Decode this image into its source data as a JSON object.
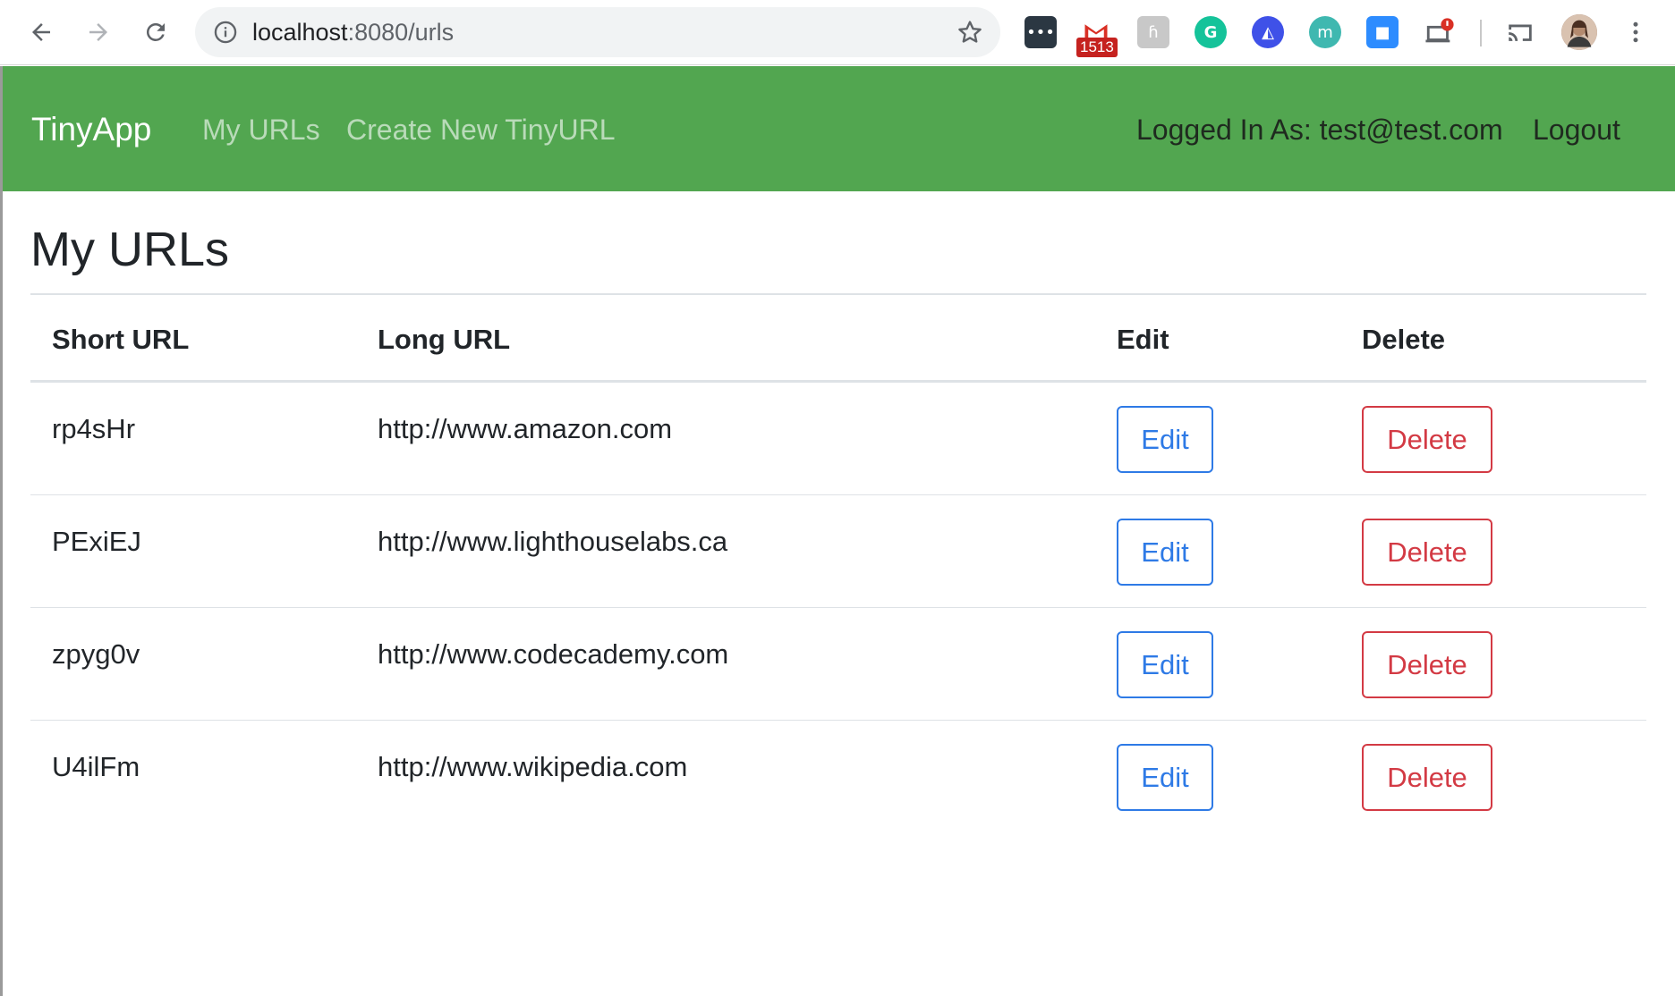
{
  "browser": {
    "url_host": "localhost",
    "url_rest": ":8080/urls",
    "gmail_count": "1513"
  },
  "navbar": {
    "brand": "TinyApp",
    "links": [
      "My URLs",
      "Create New TinyURL"
    ],
    "logged_in": "Logged In As: test@test.com",
    "logout": "Logout"
  },
  "main": {
    "title": "My URLs",
    "columns": [
      "Short URL",
      "Long URL",
      "Edit",
      "Delete"
    ],
    "rows": [
      {
        "short": "rp4sHr",
        "long": "http://www.amazon.com",
        "edit": "Edit",
        "delete": "Delete"
      },
      {
        "short": "PExiEJ",
        "long": "http://www.lighthouselabs.ca",
        "edit": "Edit",
        "delete": "Delete"
      },
      {
        "short": "zpyg0v",
        "long": "http://www.codecademy.com",
        "edit": "Edit",
        "delete": "Delete"
      },
      {
        "short": "U4ilFm",
        "long": "http://www.wikipedia.com",
        "edit": "Edit",
        "delete": "Delete"
      }
    ]
  },
  "colors": {
    "navbar": "#52a650",
    "edit": "#2e7ae6",
    "delete": "#d33a44"
  }
}
